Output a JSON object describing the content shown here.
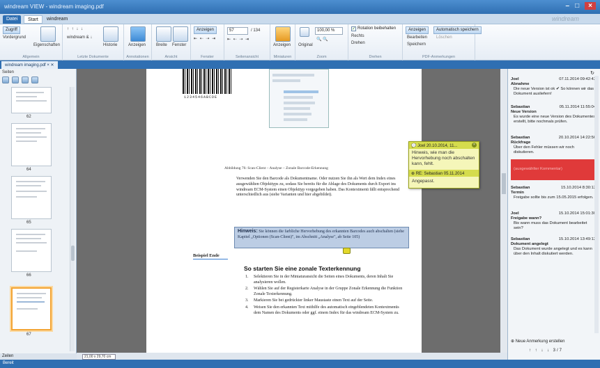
{
  "window": {
    "title": "windream VIEW - windream imaging.pdf",
    "controls": [
      "–",
      "□",
      "×"
    ]
  },
  "menu": {
    "tabs": [
      "Datei",
      "Start",
      "windream"
    ],
    "active": 1,
    "brand": "windream"
  },
  "ribbon": {
    "groups": [
      {
        "label": "Allgemein",
        "items": [
          "Zugriff",
          "Vordergrund",
          "Eigenschaften"
        ]
      },
      {
        "label": "Letzte Dokumente",
        "items": [
          "windream & ↓",
          "Historie"
        ]
      },
      {
        "label": "Annotationen",
        "items": [
          "Anzeigen"
        ]
      },
      {
        "label": "Ansicht",
        "items": [
          "Breite",
          "Fenster"
        ]
      },
      {
        "label": "Fenster",
        "items": [
          "Anzeigen"
        ]
      },
      {
        "label": "Seitenansicht",
        "page_value": "57",
        "page_total": "/ 134"
      },
      {
        "label": "Miniaturen",
        "items": [
          "Anzeigen"
        ]
      },
      {
        "label": "Zoom",
        "zoom": "100,00 %",
        "items": [
          "Original"
        ]
      },
      {
        "label": "Drehen",
        "items": [
          "Rotation beibehalten",
          "Rechts",
          "Drehen"
        ]
      },
      {
        "label": "PDF-Anmerkungen",
        "items": [
          "Anzeigen",
          "Automatisch speichern",
          "Bearbeiten",
          "Löschen",
          "Speichern"
        ]
      }
    ]
  },
  "doc_tab": {
    "label": "windream imaging.pdf"
  },
  "leftpanel": {
    "title": "Seiten",
    "page_numbers": [
      "62",
      "64",
      "65",
      "66",
      "67"
    ],
    "footer": "Zeilen"
  },
  "zoom_field": "21,00 x 29,70 cm",
  "page": {
    "barcode_number": "1234546ABCDE",
    "caption": "Abbildung 76: Scan-Client – Analyse – Zonale Barcode-Erkennung",
    "para1": "Verwenden Sie den Barcode als Dokumentname. Oder nutzen Sie ihn als Wert dem Index eines ausgewählten Objekttyps zu, sodass Sie bereits für die Ablage des Dokuments durch Export ins windream ECM-System einen Objekttyp vorgegeben haben. Das Kontextmenü fällt entsprechend unterschiedlich aus (siehe Varianten und hier abgebildet).",
    "note_title": "Hinweis:",
    "note_text": "Sie können die farbliche Hervorhebung des erkannten Barcodes auch abschalten (siehe Kapitel „Optionen (Scan-Client)\", im Abschnitt „Analyse\", ab Seite 105)",
    "example_end": "Beispiel Ende",
    "heading": "So starten Sie eine zonale Texterkennung",
    "steps": [
      "Selektieren Sie in der Miniaturansicht die Seiten eines Dokuments, deren Inhalt Sie analysieren wollen.",
      "Wählen Sie auf der Registerkarte Analyse in der Gruppe Zonale Erkennung die Funktion Zonale Texterkennung.",
      "Markieren Sie bei gedrückter linker Maustaste einen Text auf der Seite.",
      "Weisen Sie den erkannten Text mithilfe des automatisch eingeblendeten Kontextmenüs dem Namen des Dokuments oder ggf. einem Index für das windream ECM-System zu."
    ]
  },
  "popup": {
    "head1": "Joel   20.10.2014, 11...",
    "body1": "Hinweis, wie man die Hervorhebung noch abschalten kann, fehlt.",
    "head2": "RE: Sebastian   05.11.2014",
    "body2": "Angepasst."
  },
  "comments": [
    {
      "who": "Joel",
      "date": "07.11.2014 09:42:43",
      "title": "Abnahme",
      "text": "Die neue Version ist ok ✔ So können wir das Dokument ausliefern!"
    },
    {
      "who": "Sebastian",
      "date": "05.11.2014 11:55:04",
      "title": "Neue Version",
      "text": "Es wurde eine neue Version des Dokumentes erstellt, bitte nochmals prüfen."
    },
    {
      "who": "Sebastian",
      "date": "20.10.2014 14:22:56",
      "title": "Rückfrage",
      "text": "Über den Fehler müssen wir noch diskutieren."
    },
    {
      "who": "",
      "date": "",
      "title": "",
      "text": "(ausgewählter Kommentar)"
    },
    {
      "who": "Sebastian",
      "date": "15.10.2014 8:30:12",
      "title": "Termin",
      "text": "Freigabe sollte bis zum 15.05.2015 erfolgen."
    },
    {
      "who": "Joel",
      "date": "15.10.2014 15:01:30",
      "title": "Freigabe wann?",
      "text": "Bis wann muss das Dokument bearbeitet sein?"
    },
    {
      "who": "Sebastian",
      "date": "15.10.2014 13:49:12",
      "title": "Dokument angelegt",
      "text": "Das Dokument wurde angelegt und es kann über den Inhalt diskutiert werden."
    }
  ],
  "rightpanel": {
    "new_comment": "Neue Anmerkung erstellen",
    "nav": "↑ ↑ ↓ ↓   3/7"
  },
  "statusbar": {
    "text": "Bereit"
  }
}
